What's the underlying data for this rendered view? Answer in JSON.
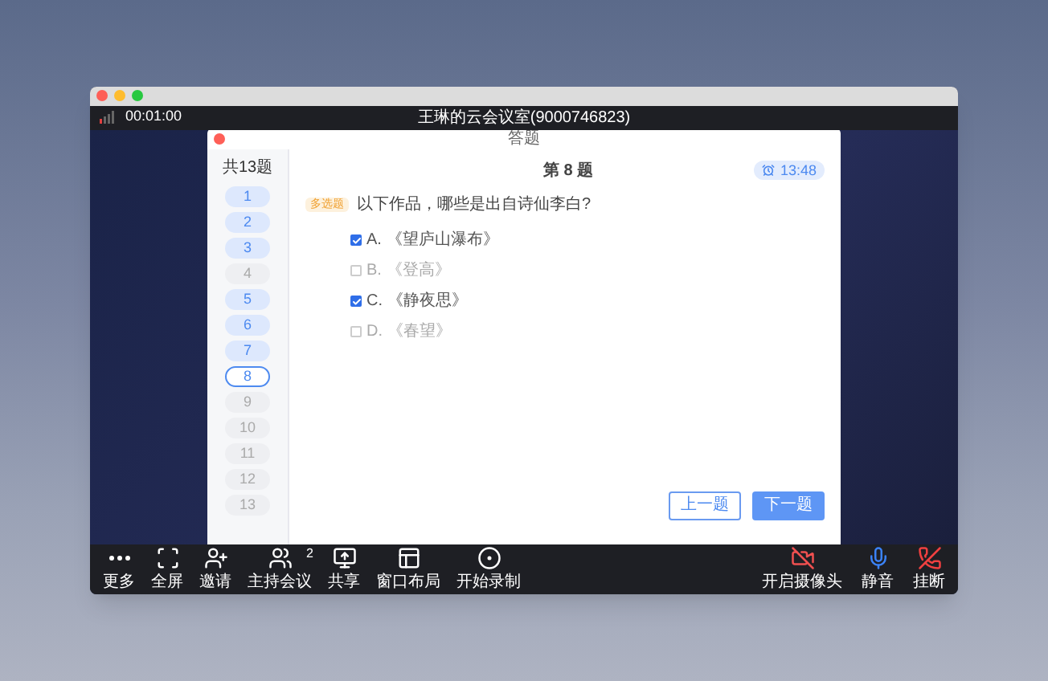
{
  "window": {
    "elapsed": "00:01:00",
    "title": "王琳的云会议室(9000746823)"
  },
  "dialog": {
    "title": "答题",
    "total": "共13题",
    "heading": "第 8 题",
    "timer": "13:48",
    "questions": [
      {
        "label": "1",
        "answered": true,
        "selected": false
      },
      {
        "label": "2",
        "answered": true,
        "selected": false
      },
      {
        "label": "3",
        "answered": true,
        "selected": false
      },
      {
        "label": "4",
        "answered": false,
        "selected": false
      },
      {
        "label": "5",
        "answered": true,
        "selected": false
      },
      {
        "label": "6",
        "answered": true,
        "selected": false
      },
      {
        "label": "7",
        "answered": true,
        "selected": false
      },
      {
        "label": "8",
        "answered": false,
        "selected": true
      },
      {
        "label": "9",
        "answered": false,
        "selected": false
      },
      {
        "label": "10",
        "answered": false,
        "selected": false
      },
      {
        "label": "11",
        "answered": false,
        "selected": false
      },
      {
        "label": "12",
        "answered": false,
        "selected": false
      },
      {
        "label": "13",
        "answered": false,
        "selected": false
      }
    ],
    "question_type": "多选题",
    "question": "以下作品，哪些是出自诗仙李白?",
    "options": [
      {
        "letter": "A.",
        "text": "《望庐山瀑布》",
        "checked": true
      },
      {
        "letter": "B.",
        "text": "《登高》",
        "checked": false
      },
      {
        "letter": "C.",
        "text": "《静夜思》",
        "checked": true
      },
      {
        "letter": "D.",
        "text": "《春望》",
        "checked": false
      }
    ],
    "buttons": {
      "prev": "上一题",
      "next": "下一题"
    }
  },
  "toolbar": {
    "left": [
      {
        "kind": "more",
        "label": "更多"
      },
      {
        "kind": "fullscreen",
        "label": "全屏"
      },
      {
        "kind": "invite",
        "label": "邀请"
      },
      {
        "kind": "host",
        "label": "主持会议",
        "badge": "2"
      },
      {
        "kind": "share",
        "label": "共享"
      },
      {
        "kind": "layout",
        "label": "窗口布局"
      },
      {
        "kind": "record",
        "label": "开始录制"
      }
    ],
    "right": [
      {
        "kind": "camera",
        "label": "开启摄像头"
      },
      {
        "kind": "mic",
        "label": "静音"
      },
      {
        "kind": "hangup",
        "label": "挂断"
      }
    ]
  }
}
